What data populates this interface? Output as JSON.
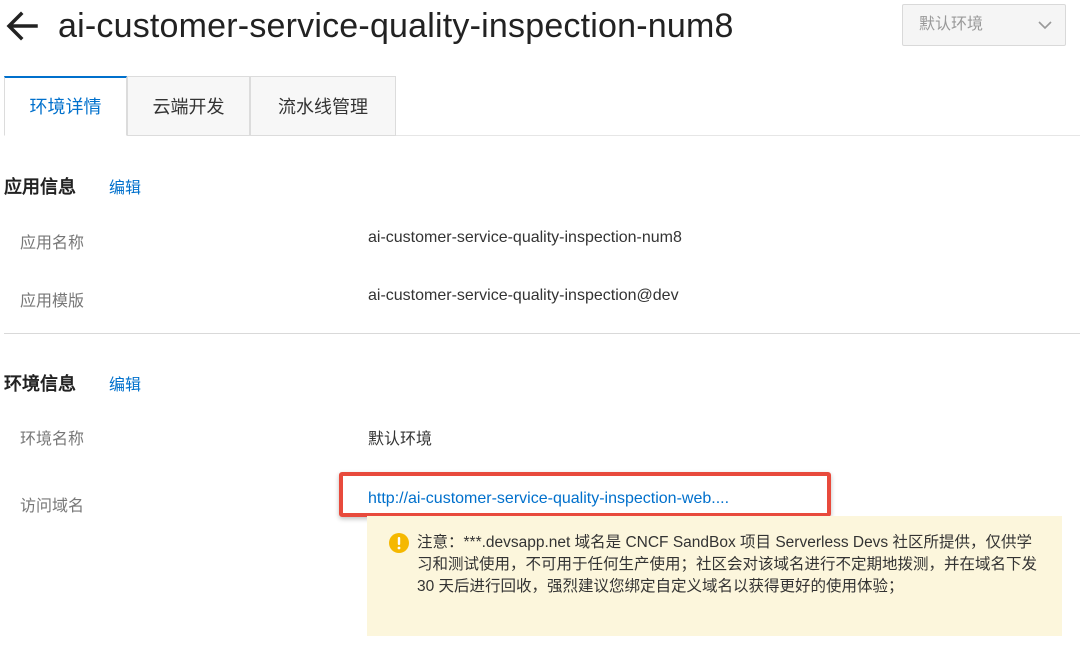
{
  "header": {
    "title": "ai-customer-service-quality-inspection-num8",
    "env_select": "默认环境"
  },
  "tabs": [
    {
      "label": "环境详情",
      "active": true
    },
    {
      "label": "云端开发",
      "active": false
    },
    {
      "label": "流水线管理",
      "active": false
    }
  ],
  "app_info": {
    "title": "应用信息",
    "edit": "编辑",
    "rows": [
      {
        "label": "应用名称",
        "value": "ai-customer-service-quality-inspection-num8"
      },
      {
        "label": "应用模版",
        "value": "ai-customer-service-quality-inspection@dev"
      }
    ]
  },
  "env_info": {
    "title": "环境信息",
    "edit": "编辑",
    "name_label": "环境名称",
    "name_value": "默认环境",
    "domain_label": "访问域名",
    "domain_value": "http://ai-customer-service-quality-inspection-web....",
    "notice": "注意：***.devsapp.net 域名是 CNCF SandBox 项目 Serverless Devs 社区所提供，仅供学习和测试使用，不可用于任何生产使用；社区会对该域名进行不定期地拨测，并在域名下发 30 天后进行回收，强烈建议您绑定自定义域名以获得更好的使用体验；"
  },
  "colors": {
    "accent": "#0070cc",
    "highlight_border": "#e84a3c",
    "notice_bg": "#fcf6dc",
    "warning": "#f5b800"
  },
  "icons": [
    "back-arrow-icon",
    "chevron-down-icon",
    "warning-icon"
  ]
}
